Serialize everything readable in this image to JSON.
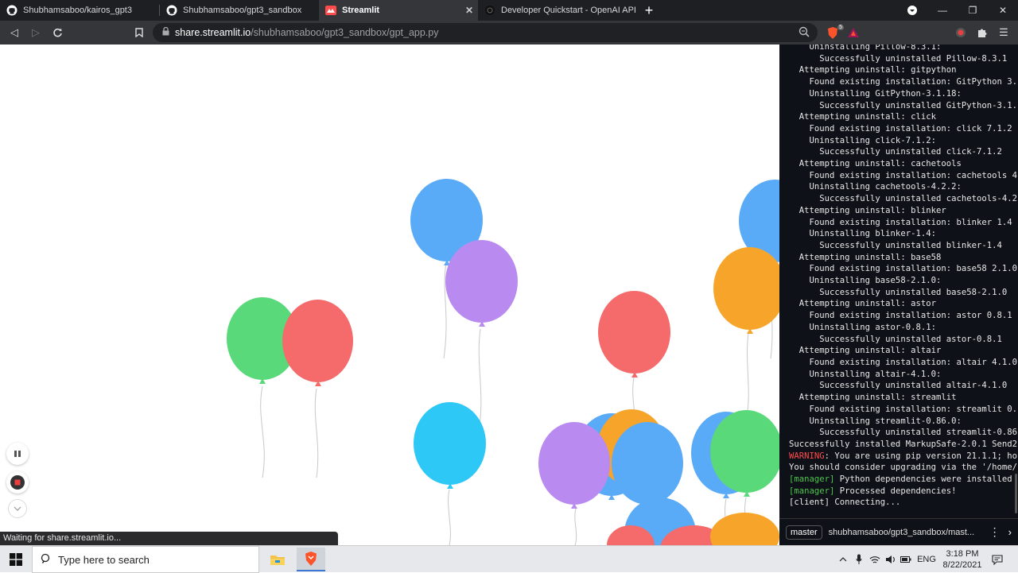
{
  "browser": {
    "tabs": [
      {
        "title": "Shubhamsaboo/kairos_gpt3",
        "icon": "github-icon",
        "active": false
      },
      {
        "title": "Shubhamsaboo/gpt3_sandbox",
        "icon": "github-icon",
        "active": false
      },
      {
        "title": "Streamlit",
        "icon": "streamlit-icon",
        "active": true
      },
      {
        "title": "Developer Quickstart - OpenAI API",
        "icon": "openai-icon",
        "active": false
      }
    ],
    "new_tab": "+",
    "url_host": "share.streamlit.io",
    "url_path": "/shubhamsaboo/gpt3_sandbox/gpt_app.py",
    "brave_badge": "5"
  },
  "terminal": {
    "lines": [
      {
        "text": "    Uninstalling Pillow-8.3.1:",
        "kind": "normal"
      },
      {
        "text": "      Successfully uninstalled Pillow-8.3.1",
        "kind": "normal"
      },
      {
        "text": "  Attempting uninstall: gitpython",
        "kind": "normal"
      },
      {
        "text": "    Found existing installation: GitPython 3.",
        "kind": "normal"
      },
      {
        "text": "    Uninstalling GitPython-3.1.18:",
        "kind": "normal"
      },
      {
        "text": "      Successfully uninstalled GitPython-3.1.",
        "kind": "normal"
      },
      {
        "text": "  Attempting uninstall: click",
        "kind": "normal"
      },
      {
        "text": "    Found existing installation: click 7.1.2",
        "kind": "normal"
      },
      {
        "text": "    Uninstalling click-7.1.2:",
        "kind": "normal"
      },
      {
        "text": "      Successfully uninstalled click-7.1.2",
        "kind": "normal"
      },
      {
        "text": "  Attempting uninstall: cachetools",
        "kind": "normal"
      },
      {
        "text": "    Found existing installation: cachetools 4",
        "kind": "normal"
      },
      {
        "text": "    Uninstalling cachetools-4.2.2:",
        "kind": "normal"
      },
      {
        "text": "      Successfully uninstalled cachetools-4.2",
        "kind": "normal"
      },
      {
        "text": "  Attempting uninstall: blinker",
        "kind": "normal"
      },
      {
        "text": "    Found existing installation: blinker 1.4",
        "kind": "normal"
      },
      {
        "text": "    Uninstalling blinker-1.4:",
        "kind": "normal"
      },
      {
        "text": "      Successfully uninstalled blinker-1.4",
        "kind": "normal"
      },
      {
        "text": "  Attempting uninstall: base58",
        "kind": "normal"
      },
      {
        "text": "    Found existing installation: base58 2.1.0",
        "kind": "normal"
      },
      {
        "text": "    Uninstalling base58-2.1.0:",
        "kind": "normal"
      },
      {
        "text": "      Successfully uninstalled base58-2.1.0",
        "kind": "normal"
      },
      {
        "text": "  Attempting uninstall: astor",
        "kind": "normal"
      },
      {
        "text": "    Found existing installation: astor 0.8.1",
        "kind": "normal"
      },
      {
        "text": "    Uninstalling astor-0.8.1:",
        "kind": "normal"
      },
      {
        "text": "      Successfully uninstalled astor-0.8.1",
        "kind": "normal"
      },
      {
        "text": "  Attempting uninstall: altair",
        "kind": "normal"
      },
      {
        "text": "    Found existing installation: altair 4.1.0",
        "kind": "normal"
      },
      {
        "text": "    Uninstalling altair-4.1.0:",
        "kind": "normal"
      },
      {
        "text": "      Successfully uninstalled altair-4.1.0",
        "kind": "normal"
      },
      {
        "text": "  Attempting uninstall: streamlit",
        "kind": "normal"
      },
      {
        "text": "    Found existing installation: streamlit 0.",
        "kind": "normal"
      },
      {
        "text": "    Uninstalling streamlit-0.86.0:",
        "kind": "normal"
      },
      {
        "text": "      Successfully uninstalled streamlit-0.86",
        "kind": "normal"
      },
      {
        "text": "Successfully installed MarkupSafe-2.0.1 Send2",
        "kind": "normal"
      },
      {
        "text": "WARNING",
        "rest": ": You are using pip version 21.1.1; ho",
        "kind": "warn"
      },
      {
        "text": "You should consider upgrading via the '/home/",
        "kind": "normal"
      },
      {
        "text": "[manager]",
        "rest": " Python dependencies were installed",
        "kind": "mgr"
      },
      {
        "text": "[manager]",
        "rest": " Processed dependencies!",
        "kind": "mgr"
      },
      {
        "text": "[client] Connecting...",
        "kind": "normal"
      }
    ],
    "branch": "master",
    "repo": "shubhamsaboo/gpt3_sandbox/mast..."
  },
  "status_text": "Waiting for share.streamlit.io...",
  "balloon_colors": {
    "blue": "#5aabf7",
    "purple": "#b98bf0",
    "green": "#5ad97a",
    "red": "#f56a6a",
    "orange": "#f7a52a",
    "cyan": "#2dc8f5"
  },
  "taskbar": {
    "search_placeholder": "Type here to search",
    "language": "ENG",
    "time": "3:18 PM",
    "date": "8/22/2021"
  }
}
